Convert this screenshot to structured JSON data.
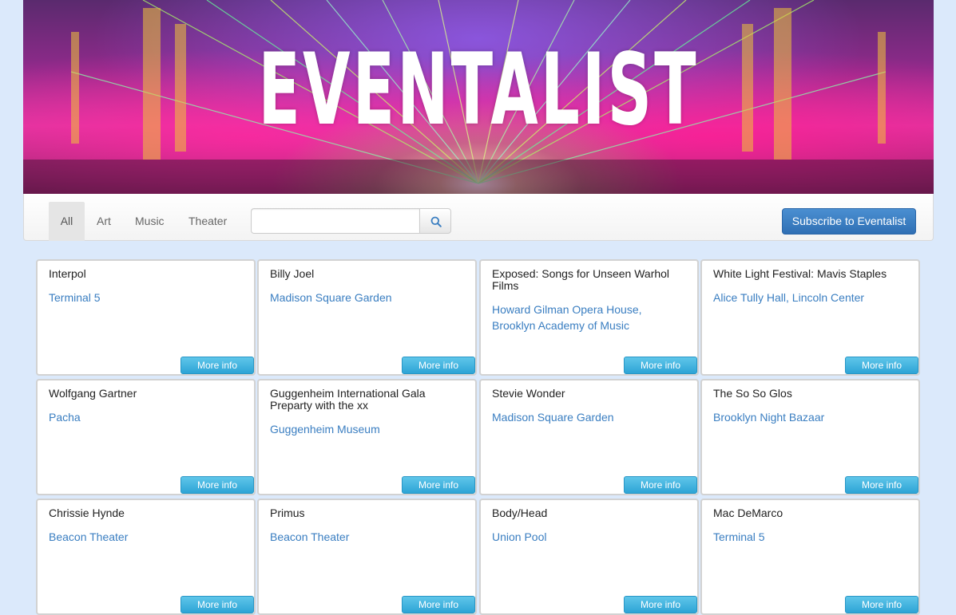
{
  "header": {
    "title": "EVENTALIST"
  },
  "nav": {
    "tabs": [
      {
        "label": "All",
        "active": true
      },
      {
        "label": "Art",
        "active": false
      },
      {
        "label": "Music",
        "active": false
      },
      {
        "label": "Theater",
        "active": false
      }
    ],
    "search": {
      "value": "",
      "placeholder": ""
    },
    "subscribe_label": "Subscribe to Eventalist"
  },
  "events": [
    {
      "title": "Interpol",
      "venue": "Terminal 5",
      "button": "More info"
    },
    {
      "title": "Billy Joel",
      "venue": "Madison Square Garden",
      "button": "More info"
    },
    {
      "title": "Exposed: Songs for Unseen Warhol Films",
      "venue": "Howard Gilman Opera House, Brooklyn Academy of Music",
      "button": "More info"
    },
    {
      "title": "White Light Festival: Mavis Staples",
      "venue": "Alice Tully Hall, Lincoln Center",
      "button": "More info"
    },
    {
      "title": "Wolfgang Gartner",
      "venue": "Pacha",
      "button": "More info"
    },
    {
      "title": "Guggenheim International Gala Preparty with the xx",
      "venue": "Guggenheim Museum",
      "button": "More info"
    },
    {
      "title": "Stevie Wonder",
      "venue": "Madison Square Garden",
      "button": "More info"
    },
    {
      "title": "The So So Glos",
      "venue": "Brooklyn Night Bazaar",
      "button": "More info"
    },
    {
      "title": "Chrissie Hynde",
      "venue": "Beacon Theater",
      "button": "More info"
    },
    {
      "title": "Primus",
      "venue": "Beacon Theater",
      "button": "More info"
    },
    {
      "title": "Body/Head",
      "venue": "Union Pool",
      "button": "More info"
    },
    {
      "title": "Mac DeMarco",
      "venue": "Terminal 5",
      "button": "More info"
    }
  ],
  "icons": {
    "search": "search-icon"
  },
  "colors": {
    "accent": "#2f6fb4",
    "link": "#3a7ec1",
    "more_info": "#2da4d6",
    "background": "#dbe9fb"
  }
}
